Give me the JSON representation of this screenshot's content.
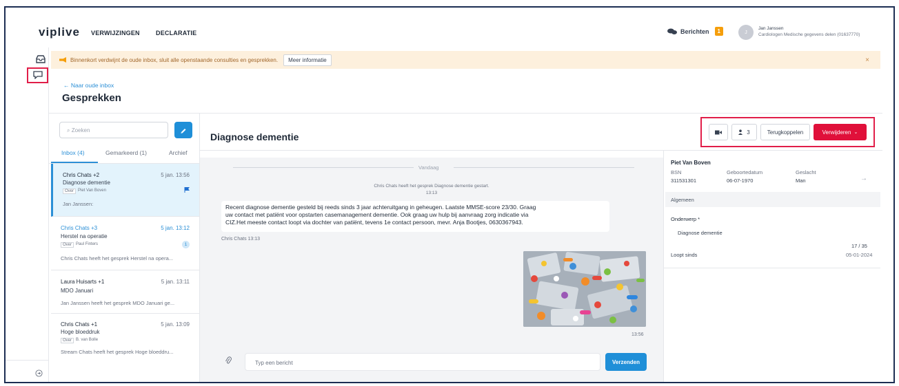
{
  "nav": {
    "logo": "viplive",
    "links": [
      "VERWIJZINGEN",
      "DECLARATIE"
    ],
    "messages_label": "Berichten",
    "messages_count": "1",
    "user_name": "Jan Janssen",
    "user_role": "Cardiologen Medische gegevens delen (01637770)"
  },
  "banner": {
    "text": "Binnenkort verdwijnt de oude inbox, sluit alle openstaande consulties en gesprekken.",
    "button": "Meer informatie",
    "close": "×"
  },
  "header": {
    "back_link": "← Naar oude inbox",
    "title": "Gesprekken"
  },
  "list": {
    "search_placeholder": "Zoeken",
    "tabs": [
      "Inbox (4)",
      "Gemarkeerd (1)",
      "Archief"
    ],
    "items": [
      {
        "name": "Chris Chats +2",
        "time": "5 jan. 13:56",
        "subject": "Diagnose dementie",
        "tag_over": "Over",
        "tag_name": "Piet Van Boven",
        "preview": "Jan Janssen:"
      },
      {
        "name": "Chris Chats +3",
        "time": "5 jan. 13:12",
        "subject": "Herstel na operatie",
        "tag_over": "Over",
        "tag_name": "Paul Finters",
        "preview": "Chris Chats heeft het gesprek Herstel na opera...",
        "count": "1"
      },
      {
        "name": "Laura Huisarts +1",
        "time": "5 jan. 13:11",
        "subject": "MDO Januari",
        "preview": "Jan Janssen heeft het gesprek MDO Januari ge..."
      },
      {
        "name": "Chris Chats +1",
        "time": "5 jan. 13:09",
        "subject": "Hoge bloeddruk",
        "tag_over": "Over",
        "tag_name": "B. van Bolle",
        "preview": "Stream Chats heeft het gesprek Hoge bloeddru..."
      }
    ]
  },
  "chat": {
    "title": "Diagnose dementie",
    "participants": "3",
    "btn_return": "Terugkoppelen",
    "btn_delete": "Verwijderen",
    "day": "Vandaag",
    "system_msg": "Chris Chats heeft het gesprek Diagnose dementie gestart.",
    "system_time": "13:13",
    "message_lines": [
      "Recent diagnose dementie gesteld bij reeds sinds 3 jaar achteruitgang in geheugen. Laatste MMSE-score 23/30. Graag",
      "uw contact met patiënt voor opstarten casemanagement dementie. Ook graag uw hulp bij aanvraag zorg indicatie via",
      "CIZ.Het meeste contact loopt via dochter van patiënt, tevens 1e contact persoon, mevr. Anja Bootjes, 0630367943."
    ],
    "sender": "Chris Chats 13:13",
    "image_time": "13:56",
    "input_placeholder": "Typ een bericht",
    "send": "Verzenden"
  },
  "patient": {
    "name": "Piet Van Boven",
    "bsn_label": "BSN",
    "bsn": "311531301",
    "dob_label": "Geboortedatum",
    "dob": "06-07-1970",
    "sex_label": "Geslacht",
    "sex": "Man",
    "section": "Algemeen",
    "subject_label": "Onderwerp *",
    "subject": "Diagnose dementie",
    "counter": "17 / 35",
    "since_label": "Loopt sinds",
    "since": "05-01-2024"
  },
  "colors": {
    "accent": "#1f8fd8",
    "danger": "#e0103a",
    "highlight": "#e11d48",
    "warning": "#f59e0b"
  }
}
